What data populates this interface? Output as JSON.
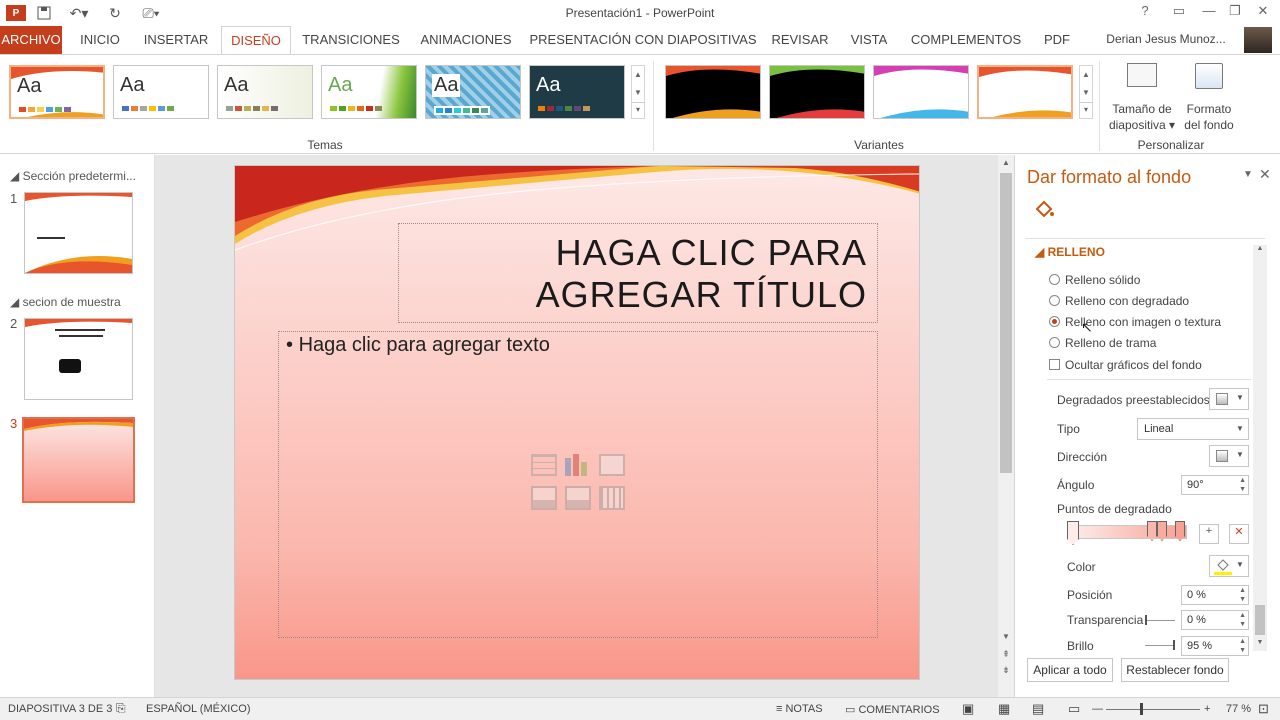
{
  "window": {
    "title": "Presentación1 - PowerPoint",
    "controls": [
      "?",
      "▭",
      "—",
      "❐",
      "✕"
    ]
  },
  "tabs": [
    {
      "label": "ARCHIVO"
    },
    {
      "label": "INICIO"
    },
    {
      "label": "INSERTAR"
    },
    {
      "label": "DISEÑO"
    },
    {
      "label": "TRANSICIONES"
    },
    {
      "label": "ANIMACIONES"
    },
    {
      "label": "PRESENTACIÓN CON DIAPOSITIVAS"
    },
    {
      "label": "REVISAR"
    },
    {
      "label": "VISTA"
    },
    {
      "label": "COMPLEMENTOS"
    },
    {
      "label": "PDF"
    }
  ],
  "user": {
    "name": "Derian Jesus Munoz..."
  },
  "ribbon": {
    "themes_label": "Temas",
    "variants_label": "Variantes",
    "customize_label": "Personalizar",
    "theme_aa": "Aa",
    "slide_size_label_1": "Tamaño de",
    "slide_size_label_2": "diapositiva",
    "format_bg_label_1": "Formato",
    "format_bg_label_2": "del fondo"
  },
  "slides_panel": {
    "section1": "Sección predetermi...",
    "section2": "secion de muestra",
    "numbers": [
      "1",
      "2",
      "3"
    ]
  },
  "slide": {
    "title_line1": "HAGA CLIC PARA",
    "title_line2": "AGREGAR TÍTULO",
    "body_bullet": "Haga clic para agregar texto"
  },
  "format_pane": {
    "title": "Dar formato al fondo",
    "section": "RELLENO",
    "options": [
      "Relleno sólido",
      "Relleno con degradado",
      "Relleno con imagen o textura",
      "Relleno de trama"
    ],
    "selected_option": 2,
    "hide_graphics": "Ocultar gráficos del fondo",
    "preset_gradients": "Degradados preestablecidos",
    "type_label": "Tipo",
    "type_value": "Lineal",
    "direction_label": "Dirección",
    "angle_label": "Ángulo",
    "angle_value": "90°",
    "gradient_stops_label": "Puntos de degradado",
    "color_label": "Color",
    "position_label": "Posición",
    "position_value": "0 %",
    "transparency_label": "Transparencia",
    "transparency_value": "0 %",
    "brightness_label": "Brillo",
    "brightness_value": "95 %",
    "apply_all": "Aplicar a todo",
    "reset_bg": "Restablecer fondo"
  },
  "statusbar": {
    "slide_info": "DIAPOSITIVA 3 DE 3",
    "language": "ESPAÑOL (MÉXICO)",
    "notes": "NOTAS",
    "comments": "COMENTARIOS",
    "zoom": "77 %"
  },
  "colors": {
    "accent": "#c43e1c",
    "pane_title": "#c55a11",
    "slide_bg_top": "#fde8e6",
    "slide_bg_bottom": "#f99689"
  }
}
